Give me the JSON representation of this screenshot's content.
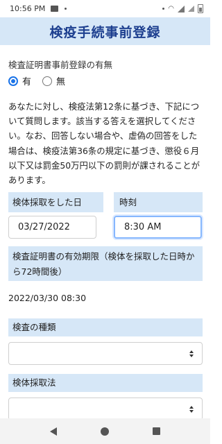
{
  "status_bar": {
    "time": "10:56 PM"
  },
  "header": {
    "title": "検疫手続事前登録"
  },
  "question": {
    "label": "検査証明書事前登録の有無",
    "options": [
      {
        "label": "有",
        "selected": true
      },
      {
        "label": "無",
        "selected": false
      }
    ]
  },
  "notice": "あなたに対し、検疫法第12条に基づき、下記について質問します。該当する答えを選択してください。なお、回答しない場合や、虚偽の回答をした場合は、検疫法第36条の規定に基づき、懲役６月以下又は罰金50万円以下の罰則が課されることがあります。",
  "sample_date": {
    "label": "検体採取をした日",
    "value": "03/27/2022"
  },
  "sample_time": {
    "label": "時刻",
    "value": "8:30 AM"
  },
  "validity": {
    "label": "検査証明書の有効期限（検体を採取した日時から72時間後）",
    "value": "2022/03/30 08:30"
  },
  "test_type": {
    "label": "検査の種類",
    "value": ""
  },
  "sample_method": {
    "label": "検体採取法",
    "value": ""
  },
  "colors": {
    "header_bg": "#d6e7f7",
    "title": "#1d3f8f",
    "accent": "#1a73e8"
  }
}
